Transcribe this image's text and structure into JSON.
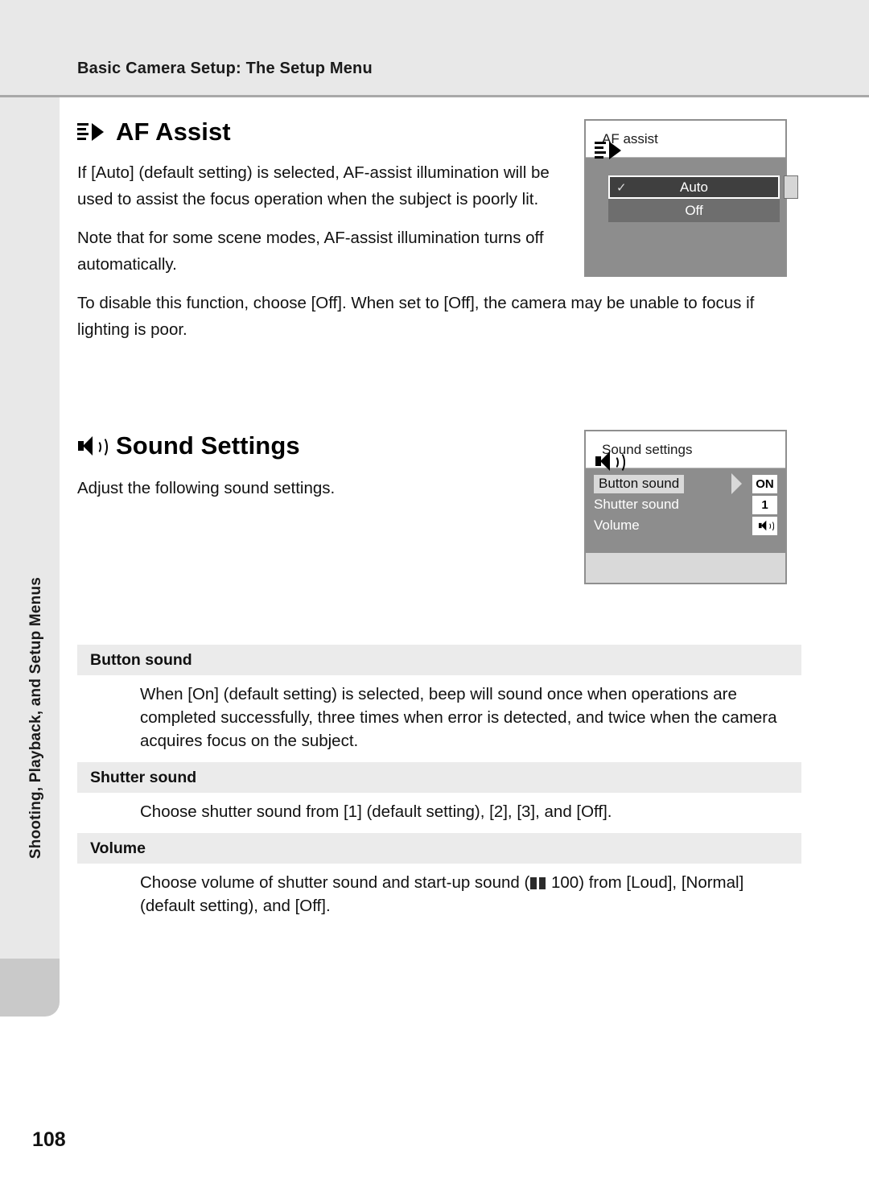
{
  "header": {
    "running_head": "Basic Camera Setup: The Setup Menu"
  },
  "side_tab": {
    "label": "Shooting, Playback, and Setup Menus"
  },
  "sections": [
    {
      "icon": "af-assist-icon",
      "title": "AF Assist",
      "paragraphs": [
        "If [Auto] (default setting) is selected, AF-assist illumination will be used to assist the focus operation when the subject is poorly lit.",
        "Note that for some scene modes, AF-assist illumination turns off automatically.",
        "To disable this function, choose [Off]. When set to [Off], the camera may be unable to focus if lighting is poor."
      ],
      "screen": {
        "title": "AF assist",
        "title_icon": "af-assist-icon",
        "options": [
          {
            "label": "Auto",
            "selected": true,
            "checked": true
          },
          {
            "label": "Off",
            "selected": false,
            "checked": false
          }
        ]
      }
    },
    {
      "icon": "speaker-icon",
      "title": "Sound Settings",
      "paragraphs": [
        "Adjust the following sound settings."
      ],
      "screen": {
        "title": "Sound settings",
        "title_icon": "speaker-icon",
        "rows": [
          {
            "label": "Button sound",
            "value": "ON",
            "value_type": "text",
            "selected": true
          },
          {
            "label": "Shutter sound",
            "value": "1",
            "value_type": "text",
            "selected": false
          },
          {
            "label": "Volume",
            "value": "speaker-icon",
            "value_type": "icon",
            "selected": false
          }
        ]
      }
    }
  ],
  "subsections": [
    {
      "heading": "Button sound",
      "body": "When [On] (default setting) is selected, beep will sound once when operations are completed successfully, three times when error is detected, and twice when the camera acquires focus on the subject."
    },
    {
      "heading": "Shutter sound",
      "body": "Choose shutter sound from [1] (default setting), [2], [3], and [Off]."
    },
    {
      "heading": "Volume",
      "body_before": "Choose volume of shutter sound and start-up sound (",
      "body_icon": "book-icon",
      "body_after": " 100) from [Loud], [Normal] (default setting), and [Off]."
    }
  ],
  "footer": {
    "page_number": "108"
  }
}
